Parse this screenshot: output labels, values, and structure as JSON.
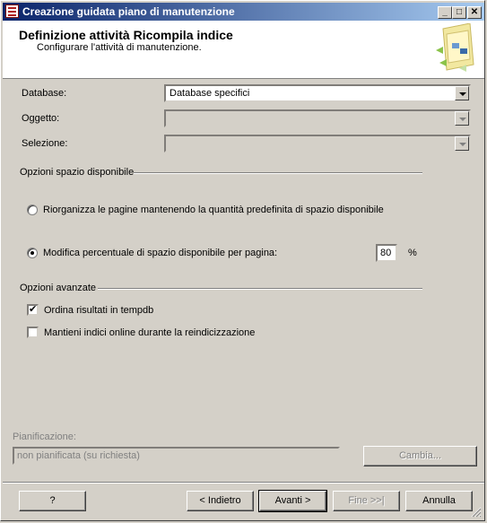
{
  "window": {
    "title": "Creazione guidata piano di manutenzione"
  },
  "header": {
    "title": "Definizione attività Ricompila indice",
    "subtitle": "Configurare l'attività di manutenzione."
  },
  "form": {
    "database_label": "Database:",
    "database_value": "Database specifici",
    "oggetto_label": "Oggetto:",
    "oggetto_value": "",
    "selezione_label": "Selezione:",
    "selezione_value": ""
  },
  "free_space": {
    "group_title": "Opzioni spazio disponibile",
    "option_reorganize": "Riorganizza le pagine mantenendo la quantità predefinita di spazio disponibile",
    "option_modify": "Modifica percentuale di spazio disponibile per pagina:",
    "percent_value": "80",
    "percent_unit": "%",
    "selected": "modify"
  },
  "advanced": {
    "group_title": "Opzioni avanzate",
    "sort_tempdb_label": "Ordina risultati in tempdb",
    "sort_tempdb_checked": true,
    "keep_online_label": "Mantieni indici online durante la reindicizzazione",
    "keep_online_checked": false
  },
  "schedule": {
    "label": "Pianificazione:",
    "value": "non pianificata (su richiesta)",
    "change_button": "Cambia..."
  },
  "buttons": {
    "help": "?",
    "back": "< Indietro",
    "next": "Avanti >",
    "finish": "Fine >>|",
    "cancel": "Annulla"
  }
}
